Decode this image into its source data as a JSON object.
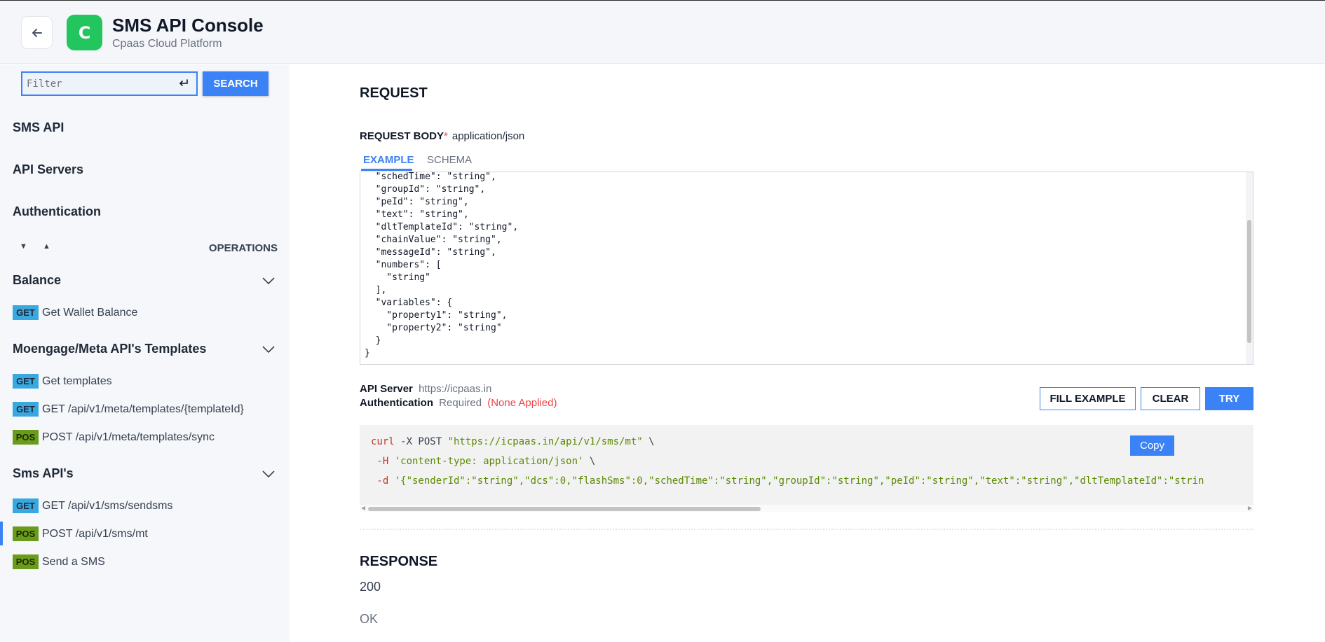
{
  "header": {
    "back_icon": "arrow-left-icon",
    "logo_letter": "C",
    "logo_color": "#22c55e",
    "title": "SMS API Console",
    "subtitle": "Cpaas Cloud Platform"
  },
  "sidebar": {
    "filter_placeholder": "Filter",
    "search_label": "SEARCH",
    "nav": [
      "SMS API",
      "API Servers",
      "Authentication"
    ],
    "operations_label": "OPERATIONS",
    "groups": [
      {
        "title": "Balance",
        "ops": [
          {
            "method": "GET",
            "label": "Get Wallet Balance"
          }
        ]
      },
      {
        "title": "Moengage/Meta API's Templates",
        "ops": [
          {
            "method": "GET",
            "label": "Get templates"
          },
          {
            "method": "GET",
            "label": "GET /api/v1/meta/templates/{templateId}"
          },
          {
            "method": "POS",
            "label": "POST /api/v1/meta/templates/sync"
          }
        ]
      },
      {
        "title": "Sms API's",
        "ops": [
          {
            "method": "GET",
            "label": "GET /api/v1/sms/sendsms"
          },
          {
            "method": "POS",
            "label": "POST /api/v1/sms/mt",
            "active": true
          },
          {
            "method": "POS",
            "label": "Send a SMS"
          }
        ]
      }
    ]
  },
  "main": {
    "request_heading": "REQUEST",
    "request_body_label": "REQUEST BODY",
    "required_star": "*",
    "content_type": "application/json",
    "tab_example": "EXAMPLE",
    "tab_schema": "SCHEMA",
    "body_lines": [
      "  \"schedTime\": \"string\",",
      "  \"groupId\": \"string\",",
      "  \"peId\": \"string\",",
      "  \"text\": \"string\",",
      "  \"dltTemplateId\": \"string\",",
      "  \"chainValue\": \"string\",",
      "  \"messageId\": \"string\",",
      "  \"numbers\": [",
      "    \"string\"",
      "  ],",
      "  \"variables\": {",
      "    \"property1\": \"string\",",
      "    \"property2\": \"string\"",
      "  }",
      "}"
    ],
    "api_server_label": "API Server",
    "api_server_url": "https://icpaas.in",
    "auth_label": "Authentication",
    "auth_required": "Required",
    "auth_status": "(None Applied)",
    "btn_fill_example": "FILL EXAMPLE",
    "btn_clear": "CLEAR",
    "btn_try": "TRY",
    "curl": {
      "line1_cmd": "curl",
      "line1_flag": " -X POST ",
      "line1_url": "\"https://icpaas.in/api/v1/sms/mt\"",
      "line1_end": " \\",
      "line2_flag": " -H ",
      "line2_val": "'content-type: application/json'",
      "line2_end": " \\",
      "line3_flag": " -d ",
      "line3_val": "'{\"senderId\":\"string\",\"dcs\":0,\"flashSms\":0,\"schedTime\":\"string\",\"groupId\":\"string\",\"peId\":\"string\",\"text\":\"string\",\"dltTemplateId\":\"strin"
    },
    "copy_label": "Copy",
    "response_heading": "RESPONSE",
    "response_code": "200",
    "response_text": "OK"
  },
  "colors": {
    "accent": "#3b82f6",
    "get_badge": "#38a8e0",
    "post_badge": "#6b9b1a",
    "required": "#ef4444"
  }
}
